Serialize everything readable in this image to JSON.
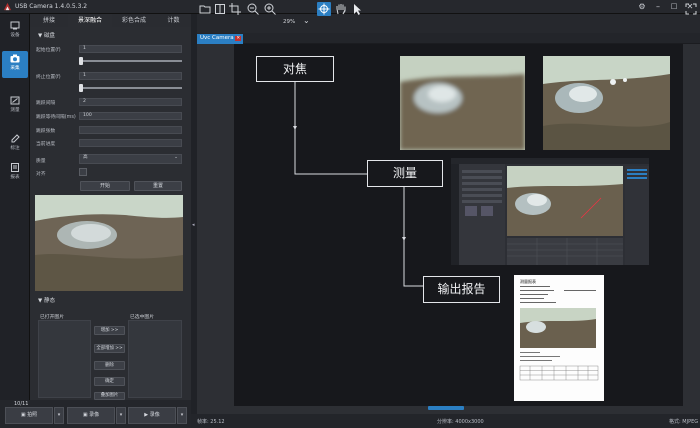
{
  "app": {
    "title": "USB Camera   1.4.0.5.3.2"
  },
  "rail": [
    {
      "label": "设备",
      "icon": "device-icon"
    },
    {
      "label": "采集",
      "icon": "camera-icon"
    },
    {
      "label": "测量",
      "icon": "measure-icon"
    },
    {
      "label": "标注",
      "icon": "annotate-icon"
    },
    {
      "label": "报表",
      "icon": "report-icon"
    }
  ],
  "panel_tabs": [
    "拼接",
    "景深融合",
    "彩色合成",
    "计数"
  ],
  "dof": {
    "section": "▼ 磁盘",
    "start_label": "起始位置(f)",
    "start_value": "1",
    "end_label": "终止位置(f)",
    "end_value": "1",
    "step_label": "跳跃间隔",
    "step_value": "2",
    "wait_label": "跳跃等待间隔(ms)",
    "wait_value": "100",
    "frames_label": "跳跃张数",
    "progress_label": "当前进度",
    "quality_label": "质量",
    "quality_value": "高",
    "align_label": "对齐",
    "start_button": "开始",
    "reset_button": "重置"
  },
  "gallery": {
    "section": "▼ 静态",
    "opened_label": "已打开图片",
    "selected_label": "已选中图片",
    "add_button": "增加 >>",
    "add_all_button": "全部增加 >>",
    "delete_button": "删除",
    "confirm_button": "确定",
    "overlay_button": "叠加图片"
  },
  "bottom": {
    "counter": "10/11",
    "capture": "拍照",
    "record": "录像",
    "video": "录像"
  },
  "toolbar": {
    "zoom": "29%"
  },
  "doc_tab": {
    "label": "Uvc Camera"
  },
  "workflow": {
    "focus": "对焦",
    "measure": "测量",
    "report": "输出报告"
  },
  "report": {
    "title": "测量报表"
  },
  "status": {
    "frame_rate": "帧率: 25.12",
    "resolution": "分辨率: 4000x3000",
    "format": "格式: MJPEG"
  },
  "colors": {
    "accent": "#2b7fc3",
    "panel": "#2b2d32",
    "canvas": "#17181c"
  }
}
